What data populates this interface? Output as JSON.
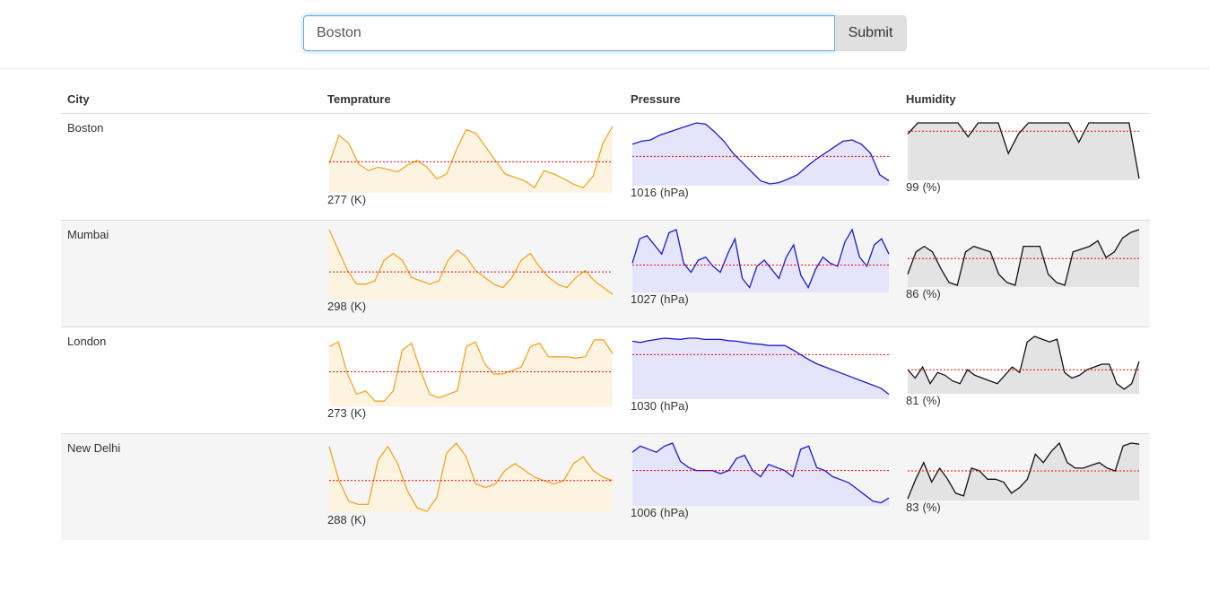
{
  "search": {
    "value": "Boston",
    "submit_label": "Submit"
  },
  "table": {
    "headers": {
      "city": "City",
      "temperature": "Temprature",
      "pressure": "Pressure",
      "humidity": "Humidity"
    },
    "units": {
      "temperature": "(K)",
      "pressure": "(hPa)",
      "humidity": "(%)"
    },
    "rows": [
      {
        "city": "Boston",
        "temperature": "277",
        "pressure": "1016",
        "humidity": "99"
      },
      {
        "city": "Mumbai",
        "temperature": "298",
        "pressure": "1027",
        "humidity": "86"
      },
      {
        "city": "London",
        "temperature": "273",
        "pressure": "1030",
        "humidity": "81"
      },
      {
        "city": "New Delhi",
        "temperature": "288",
        "pressure": "1006",
        "humidity": "83"
      }
    ]
  },
  "colors": {
    "temperature_line": "#f5a623",
    "temperature_fill": "#fdf3e1",
    "pressure_line": "#1a1acc",
    "pressure_fill": "#e4e4fb",
    "humidity_line": "#111111",
    "humidity_fill": "#e3e3e3",
    "mean_line": "#ff0000"
  },
  "chart_data": [
    {
      "type": "area",
      "metric": "temperature",
      "series": [
        {
          "city": "Boston",
          "values": [
            0.4,
            0.82,
            0.7,
            0.4,
            0.3,
            0.35,
            0.32,
            0.28,
            0.38,
            0.45,
            0.35,
            0.18,
            0.25,
            0.6,
            0.9,
            0.85,
            0.65,
            0.45,
            0.25,
            0.2,
            0.15,
            0.05,
            0.3,
            0.25,
            0.18,
            0.1,
            0.05,
            0.22,
            0.7,
            0.95
          ],
          "mean": 0.43
        },
        {
          "city": "Mumbai",
          "values": [
            1.0,
            0.7,
            0.4,
            0.2,
            0.2,
            0.25,
            0.55,
            0.65,
            0.55,
            0.3,
            0.25,
            0.2,
            0.25,
            0.55,
            0.7,
            0.6,
            0.4,
            0.3,
            0.2,
            0.15,
            0.3,
            0.55,
            0.65,
            0.45,
            0.3,
            0.2,
            0.15,
            0.3,
            0.4,
            0.25,
            0.15,
            0.05
          ],
          "mean": 0.38
        },
        {
          "city": "London",
          "values": [
            0.85,
            0.92,
            0.45,
            0.15,
            0.2,
            0.05,
            0.05,
            0.2,
            0.8,
            0.9,
            0.5,
            0.15,
            0.1,
            0.15,
            0.2,
            0.85,
            0.92,
            0.6,
            0.45,
            0.45,
            0.5,
            0.55,
            0.85,
            0.9,
            0.7,
            0.7,
            0.7,
            0.68,
            0.7,
            0.95,
            0.95,
            0.75
          ],
          "mean": 0.48
        },
        {
          "city": "New Delhi",
          "values": [
            0.95,
            0.45,
            0.15,
            0.1,
            0.1,
            0.75,
            0.95,
            0.7,
            0.3,
            0.05,
            0.0,
            0.2,
            0.85,
            1.0,
            0.8,
            0.4,
            0.35,
            0.4,
            0.6,
            0.7,
            0.6,
            0.5,
            0.45,
            0.4,
            0.45,
            0.7,
            0.8,
            0.6,
            0.5,
            0.45
          ],
          "mean": 0.45
        }
      ]
    },
    {
      "type": "area",
      "metric": "pressure",
      "series": [
        {
          "city": "Boston",
          "values": [
            0.65,
            0.7,
            0.72,
            0.8,
            0.85,
            0.9,
            0.95,
            1.0,
            0.98,
            0.85,
            0.7,
            0.5,
            0.35,
            0.2,
            0.05,
            0.0,
            0.02,
            0.08,
            0.15,
            0.28,
            0.4,
            0.5,
            0.6,
            0.7,
            0.72,
            0.65,
            0.5,
            0.15,
            0.05
          ],
          "mean": 0.45
        },
        {
          "city": "Mumbai",
          "values": [
            0.45,
            0.85,
            0.9,
            0.75,
            0.6,
            0.95,
            1.0,
            0.45,
            0.3,
            0.5,
            0.55,
            0.4,
            0.3,
            0.6,
            0.85,
            0.2,
            0.05,
            0.4,
            0.5,
            0.35,
            0.2,
            0.55,
            0.75,
            0.25,
            0.05,
            0.35,
            0.55,
            0.45,
            0.4,
            0.8,
            1.0,
            0.55,
            0.4,
            0.75,
            0.85,
            0.6
          ],
          "mean": 0.42
        },
        {
          "city": "London",
          "values": [
            0.92,
            0.9,
            0.93,
            0.95,
            0.97,
            0.96,
            0.95,
            0.97,
            0.97,
            0.95,
            0.95,
            0.95,
            0.93,
            0.92,
            0.9,
            0.88,
            0.87,
            0.85,
            0.85,
            0.85,
            0.78,
            0.7,
            0.62,
            0.55,
            0.5,
            0.45,
            0.4,
            0.35,
            0.3,
            0.25,
            0.2,
            0.15,
            0.05
          ],
          "mean": 0.7
        },
        {
          "city": "New Delhi",
          "values": [
            0.85,
            0.95,
            0.9,
            0.85,
            0.95,
            1.0,
            0.7,
            0.6,
            0.55,
            0.55,
            0.55,
            0.5,
            0.55,
            0.75,
            0.8,
            0.55,
            0.45,
            0.65,
            0.6,
            0.55,
            0.45,
            0.9,
            0.95,
            0.6,
            0.55,
            0.45,
            0.4,
            0.35,
            0.25,
            0.15,
            0.05,
            0.02,
            0.1
          ],
          "mean": 0.55
        }
      ]
    },
    {
      "type": "area",
      "metric": "humidity",
      "series": [
        {
          "city": "Boston",
          "values": [
            0.8,
            1.0,
            1.0,
            1.0,
            1.0,
            1.0,
            0.75,
            1.0,
            1.0,
            1.0,
            0.45,
            0.8,
            1.0,
            1.0,
            1.0,
            1.0,
            1.0,
            0.65,
            1.0,
            1.0,
            1.0,
            1.0,
            1.0,
            0.0
          ],
          "mean": 0.85
        },
        {
          "city": "Mumbai",
          "values": [
            0.2,
            0.6,
            0.7,
            0.6,
            0.3,
            0.05,
            0.0,
            0.6,
            0.7,
            0.65,
            0.6,
            0.2,
            0.05,
            0.0,
            0.7,
            0.7,
            0.7,
            0.2,
            0.05,
            0.0,
            0.6,
            0.65,
            0.7,
            0.8,
            0.5,
            0.6,
            0.85,
            0.95,
            1.0
          ],
          "mean": 0.48
        },
        {
          "city": "London",
          "values": [
            0.4,
            0.25,
            0.45,
            0.15,
            0.35,
            0.3,
            0.2,
            0.15,
            0.4,
            0.3,
            0.25,
            0.2,
            0.15,
            0.3,
            0.45,
            0.35,
            0.9,
            1.0,
            0.95,
            0.9,
            0.95,
            0.35,
            0.25,
            0.3,
            0.4,
            0.45,
            0.5,
            0.5,
            0.15,
            0.05,
            0.15,
            0.55
          ],
          "mean": 0.4
        },
        {
          "city": "New Delhi",
          "values": [
            0.0,
            0.35,
            0.65,
            0.3,
            0.55,
            0.35,
            0.1,
            0.05,
            0.55,
            0.5,
            0.35,
            0.35,
            0.3,
            0.1,
            0.2,
            0.35,
            0.8,
            0.65,
            0.85,
            1.0,
            0.65,
            0.55,
            0.55,
            0.6,
            0.65,
            0.55,
            0.5,
            0.95,
            1.0,
            0.98
          ],
          "mean": 0.5
        }
      ]
    }
  ]
}
